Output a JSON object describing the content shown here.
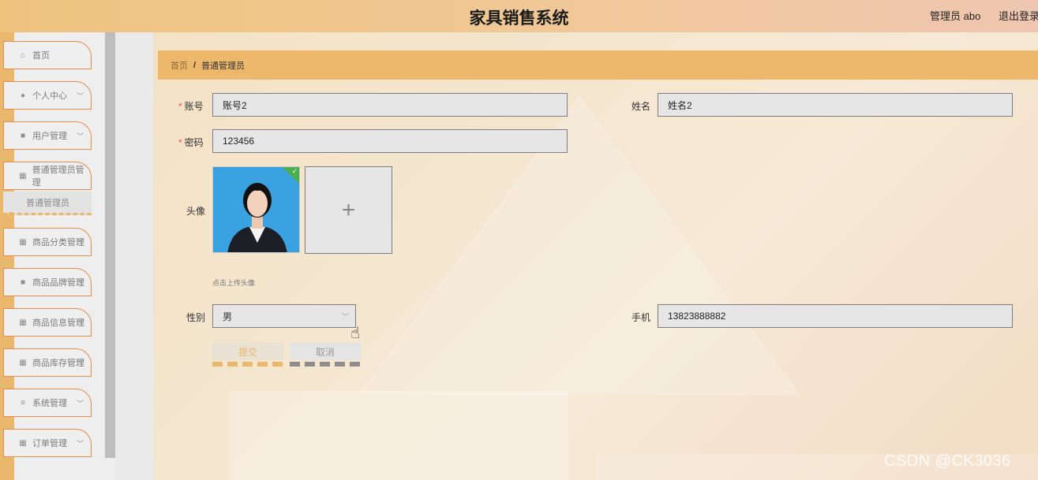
{
  "header": {
    "title": "家具销售系统",
    "user": "管理员 abo",
    "logout": "退出登录"
  },
  "sidebar": {
    "items": [
      {
        "icon": "home-icon",
        "glyph": "⌂",
        "label": "首页",
        "has_chevron": false
      },
      {
        "icon": "user-icon",
        "glyph": "●",
        "label": "个人中心",
        "has_chevron": true
      },
      {
        "icon": "thumb-icon",
        "glyph": "■",
        "label": "用户管理",
        "has_chevron": true
      },
      {
        "icon": "grid-icon",
        "glyph": "▦",
        "label": "普通管理员管理",
        "has_chevron": false
      },
      {
        "icon": "grid-icon",
        "glyph": "▦",
        "label": "商品分类管理",
        "has_chevron": true
      },
      {
        "icon": "bag-icon",
        "glyph": "■",
        "label": "商品品牌管理",
        "has_chevron": true
      },
      {
        "icon": "grid-icon",
        "glyph": "▦",
        "label": "商品信息管理",
        "has_chevron": true
      },
      {
        "icon": "grid-icon",
        "glyph": "▦",
        "label": "商品库存管理",
        "has_chevron": true
      },
      {
        "icon": "menu-icon",
        "glyph": "≡",
        "label": "系统管理",
        "has_chevron": true
      },
      {
        "icon": "grid-icon",
        "glyph": "▦",
        "label": "订单管理",
        "has_chevron": true
      }
    ],
    "sub_item": "普通管理员"
  },
  "breadcrumb": {
    "home": "首页",
    "separator": "/",
    "current": "普通管理员"
  },
  "form": {
    "account_label": "账号",
    "account_value": "账号2",
    "name_label": "姓名",
    "name_value": "姓名2",
    "password_label": "密码",
    "password_value": "123456",
    "avatar_label": "头像",
    "upload_plus": "+",
    "upload_hint": "点击上传头像",
    "gender_label": "性别",
    "gender_value": "男",
    "phone_label": "手机",
    "phone_value": "13823888882",
    "submit": "提交",
    "cancel": "取消"
  },
  "watermark": "CSDN @CK3036",
  "colors": {
    "accent": "#e9b86c",
    "menu_border": "#e88a4b",
    "required": "#e55555"
  }
}
